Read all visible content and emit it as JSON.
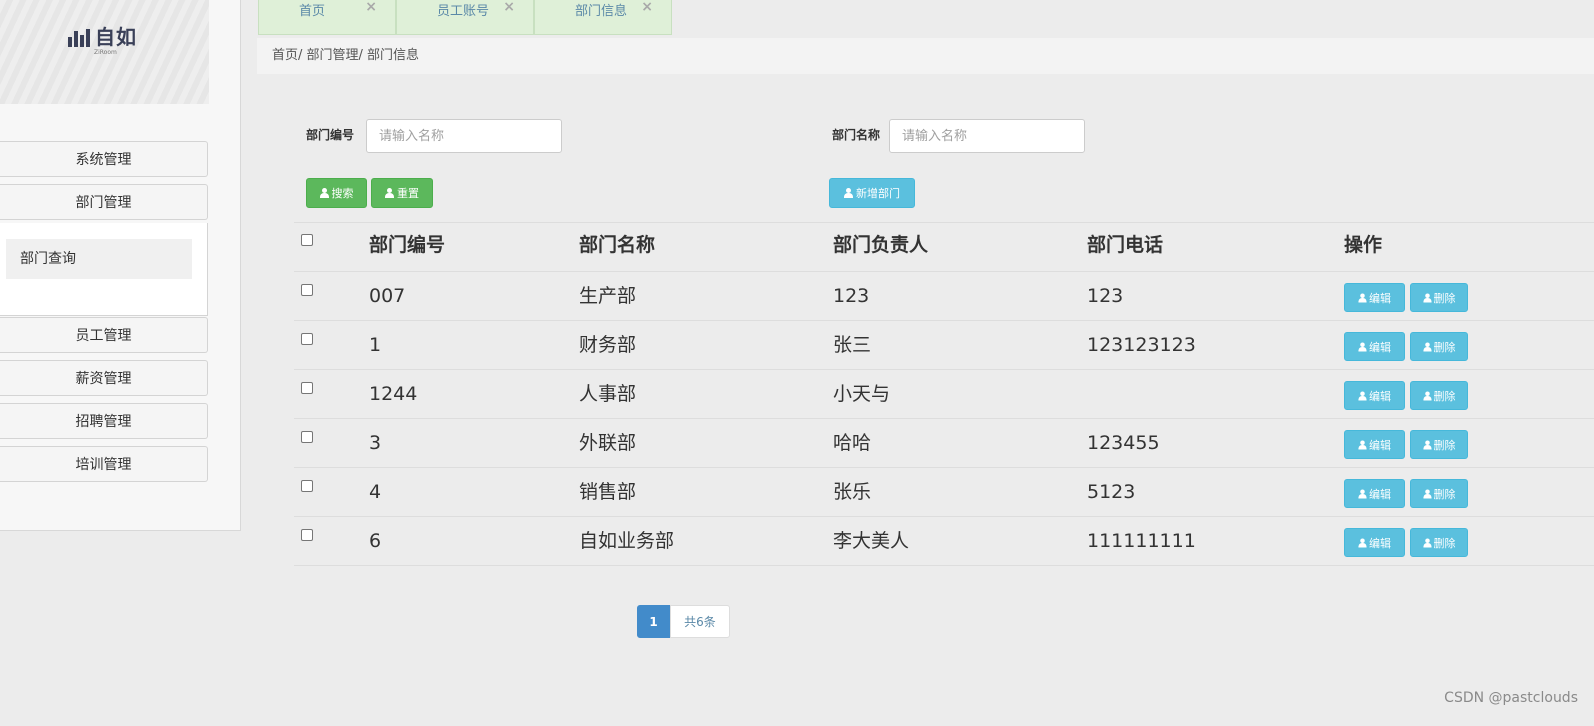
{
  "sidebar": {
    "logo_text": "自如",
    "logo_sub": "ZiRoom",
    "menu": [
      {
        "label": "系统管理"
      },
      {
        "label": "部门管理"
      },
      {
        "label": "员工管理"
      },
      {
        "label": "薪资管理"
      },
      {
        "label": "招聘管理"
      },
      {
        "label": "培训管理"
      }
    ],
    "submenu_item": "部门查询"
  },
  "tabs": [
    {
      "label": "首页",
      "close": "×"
    },
    {
      "label": "员工账号",
      "close": "×"
    },
    {
      "label": "部门信息",
      "close": "×"
    }
  ],
  "breadcrumb": "首页/ 部门管理/ 部门信息",
  "search": {
    "dept_no_label": "部门编号",
    "dept_no_placeholder": "请输入名称",
    "dept_name_label": "部门名称",
    "dept_name_placeholder": "请输入名称",
    "search_button": "搜索",
    "reset_button": "重置",
    "add_button": "新增部门"
  },
  "table": {
    "headers": [
      "部门编号",
      "部门名称",
      "部门负责人",
      "部门电话",
      "操作"
    ],
    "rows": [
      [
        "007",
        "生产部",
        "123",
        "123"
      ],
      [
        "1",
        "财务部",
        "张三",
        "123123123"
      ],
      [
        "1244",
        "人事部",
        "小天与",
        ""
      ],
      [
        "3",
        "外联部",
        "哈哈",
        "123455"
      ],
      [
        "4",
        "销售部",
        "张乐",
        "5123"
      ],
      [
        "6",
        "自如业务部",
        "李大美人",
        "111111111"
      ]
    ],
    "edit_label": "编辑",
    "delete_label": "删除"
  },
  "pagination": {
    "current": "1",
    "total": "共6条"
  },
  "watermark": "CSDN @pastclouds",
  "colors": {
    "primary": "#428bca",
    "success": "#5cb85c",
    "info": "#5bc0de",
    "tab_bg": "#dff0d8"
  }
}
